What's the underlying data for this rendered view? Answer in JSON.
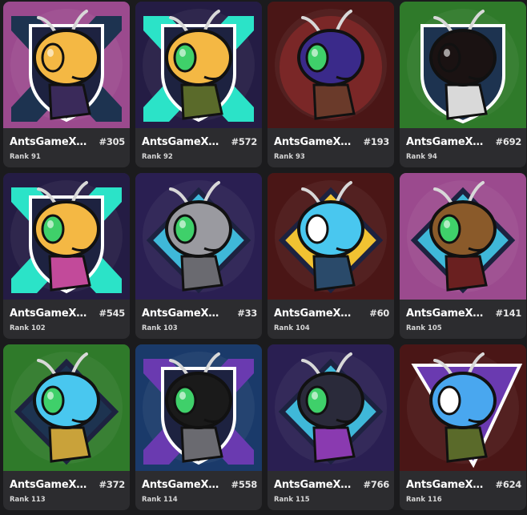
{
  "collection": "AntsGameXtr",
  "cards": [
    {
      "name": "AntsGameXtr...",
      "number": "#305",
      "rank": "Rank 91",
      "bg": "#9b4a8e",
      "emblem": "x-shield",
      "emblem_color": "#1d3350",
      "head": "#f4b844",
      "eye": "#f4b844",
      "accent": "#3a2a5a",
      "icon": "ant-bandana"
    },
    {
      "name": "AntsGameXtr...",
      "number": "#572",
      "rank": "Rank 92",
      "bg": "#241c44",
      "emblem": "x-shield",
      "emblem_color": "#2be3c8",
      "head": "#f4b844",
      "eye": "#3fd06a",
      "accent": "#5a6a2a",
      "icon": "ant-camo"
    },
    {
      "name": "AntsGameXtr...",
      "number": "#193",
      "rank": "Rank 93",
      "bg": "#4a1616",
      "emblem": "circle",
      "emblem_color": "#8c2b2b",
      "head": "#3a2a8a",
      "eye": "#3fd06a",
      "accent": "#6a3a2a",
      "icon": "ant-galaxy"
    },
    {
      "name": "AntsGameXtr...",
      "number": "#692",
      "rank": "Rank 94",
      "bg": "#2f7a2a",
      "emblem": "shield",
      "emblem_color": "#1d3350",
      "head": "#1a1212",
      "eye": "#1a1212",
      "accent": "#d9d9d9",
      "icon": "ant-lava"
    },
    {
      "name": "AntsGameXt...",
      "number": "#545",
      "rank": "Rank 102",
      "bg": "#241c44",
      "emblem": "x-shield",
      "emblem_color": "#2be3c8",
      "head": "#f4b844",
      "eye": "#3fd06a",
      "accent": "#c24a9a",
      "icon": "ant-neon"
    },
    {
      "name": "AntsGameXtr...",
      "number": "#33",
      "rank": "Rank 103",
      "bg": "#2a1f52",
      "emblem": "diamond",
      "emblem_color": "#3fb8d9",
      "head": "#9a9aa0",
      "eye": "#3fd06a",
      "accent": "#6a6a70",
      "icon": "ant-robot"
    },
    {
      "name": "AntsGameXtr...",
      "number": "#60",
      "rank": "Rank 104",
      "bg": "#4a1616",
      "emblem": "diamond",
      "emblem_color": "#f1c232",
      "head": "#49c7ef",
      "eye": "#ffffff",
      "accent": "#2a4a6a",
      "icon": "ant-crystal"
    },
    {
      "name": "AntsGameXtr...",
      "number": "#141",
      "rank": "Rank 105",
      "bg": "#9b4a8e",
      "emblem": "diamond",
      "emblem_color": "#3fb8d9",
      "head": "#8a5a2a",
      "eye": "#3fd06a",
      "accent": "#6a2020",
      "icon": "ant-leather"
    },
    {
      "name": "AntsGameXtr...",
      "number": "#372",
      "rank": "Rank 113",
      "bg": "#2f7a2a",
      "emblem": "diamond",
      "emblem_color": "#1d3350",
      "head": "#49c7ef",
      "eye": "#3fd06a",
      "accent": "#c9a23a",
      "icon": "ant-gold"
    },
    {
      "name": "AntsGameXt...",
      "number": "#558",
      "rank": "Rank 114",
      "bg": "#1a3a6a",
      "emblem": "x-shield",
      "emblem_color": "#6a3ab0",
      "head": "#1a1a1a",
      "eye": "#3fd06a",
      "accent": "#6a6a70",
      "icon": "ant-carbon"
    },
    {
      "name": "AntsGameXtr...",
      "number": "#766",
      "rank": "Rank 115",
      "bg": "#2a1f52",
      "emblem": "diamond",
      "emblem_color": "#3fb8d9",
      "head": "#2a2a3a",
      "eye": "#3fd06a",
      "accent": "#8a3ab0",
      "icon": "ant-purple-tech"
    },
    {
      "name": "AntsGameXtr...",
      "number": "#624",
      "rank": "Rank 116",
      "bg": "#4a1616",
      "emblem": "triangle",
      "emblem_color": "#6a3ab0",
      "head": "#49a7ef",
      "eye": "#ffffff",
      "accent": "#5a6a2a",
      "icon": "ant-ice"
    }
  ]
}
